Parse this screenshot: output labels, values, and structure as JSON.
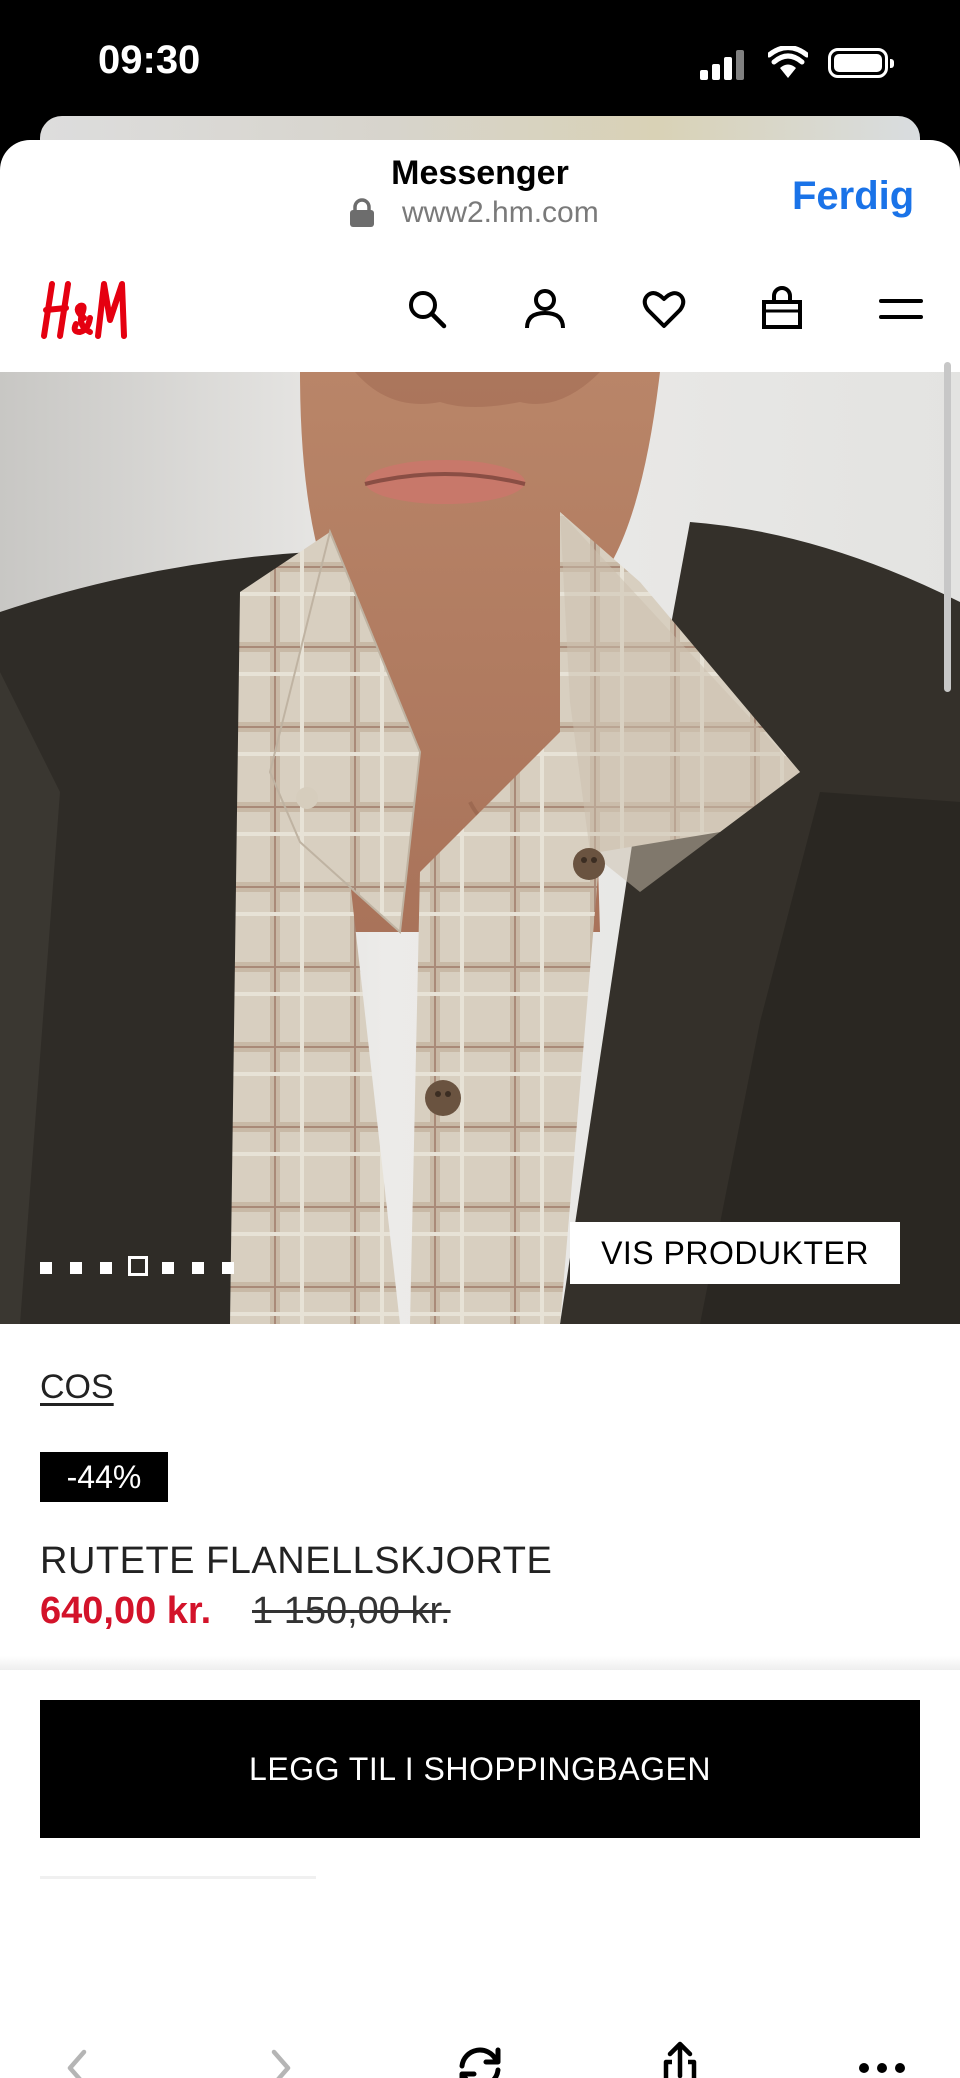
{
  "status_bar": {
    "time": "09:30"
  },
  "browser": {
    "title": "Messenger",
    "url": "www2.hm.com",
    "done_label": "Ferdig"
  },
  "site_header": {
    "logo_text": "H&M",
    "icons": [
      "search-icon",
      "account-icon",
      "favorites-icon",
      "shopping-bag-icon",
      "menu-icon"
    ]
  },
  "hero": {
    "image_dots": 7,
    "active_dot": 4,
    "show_products_label": "VIS PRODUKTER"
  },
  "product": {
    "brand": "COS",
    "discount": "-44%",
    "name": "RUTETE FLANELLSKJORTE",
    "price_sale": "640,00 kr.",
    "price_original": "1 150,00 kr."
  },
  "cta": {
    "add_to_bag_label": "LEGG TIL I SHOPPINGBAGEN"
  },
  "toolbar": {
    "icons": [
      "back-icon",
      "forward-icon",
      "reload-icon",
      "share-icon",
      "more-icon"
    ]
  },
  "colors": {
    "sale_red": "#d3132a",
    "link_blue": "#1a73e8",
    "hm_red": "#e50010"
  }
}
